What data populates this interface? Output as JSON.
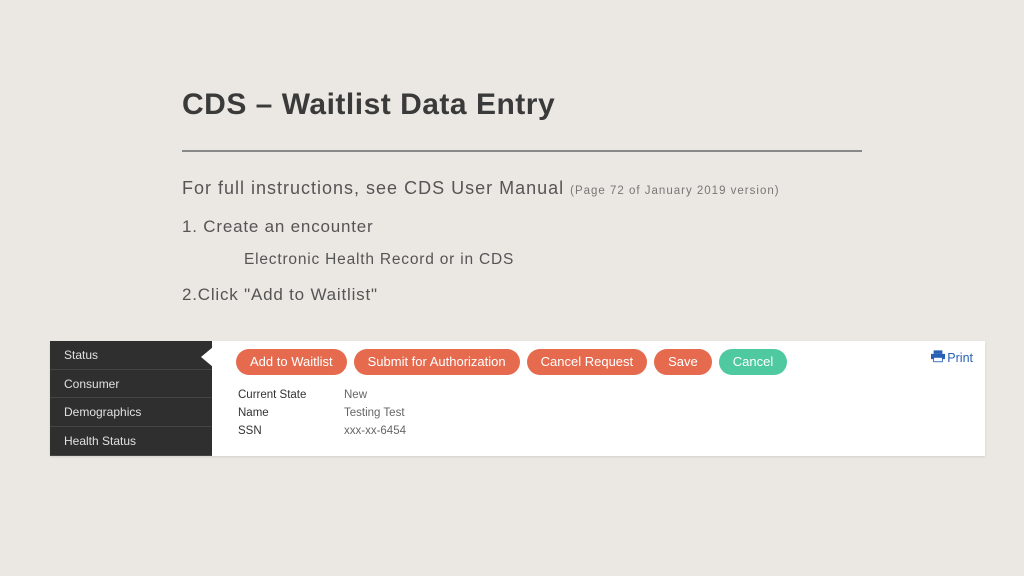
{
  "slide": {
    "title": "CDS – Waitlist Data Entry",
    "instruction_main": "For full instructions, see CDS User Manual ",
    "instruction_note": "(Page 72 of January 2019 version)",
    "step1": "1. Create an encounter",
    "step1_sub": "Electronic Health Record or in CDS",
    "step2": "2.Click \"Add to Waitlist\""
  },
  "app": {
    "sidebar": {
      "items": [
        {
          "label": "Status"
        },
        {
          "label": "Consumer"
        },
        {
          "label": "Demographics"
        },
        {
          "label": "Health Status"
        }
      ]
    },
    "buttons": {
      "add_waitlist": "Add to Waitlist",
      "submit_auth": "Submit for Authorization",
      "cancel_request": "Cancel Request",
      "save": "Save",
      "cancel": "Cancel"
    },
    "print_label": "Print",
    "details": {
      "rows": [
        {
          "label": "Current State",
          "value": "New"
        },
        {
          "label": "Name",
          "value": "Testing Test"
        },
        {
          "label": "SSN",
          "value": "xxx-xx-6454"
        }
      ]
    }
  }
}
